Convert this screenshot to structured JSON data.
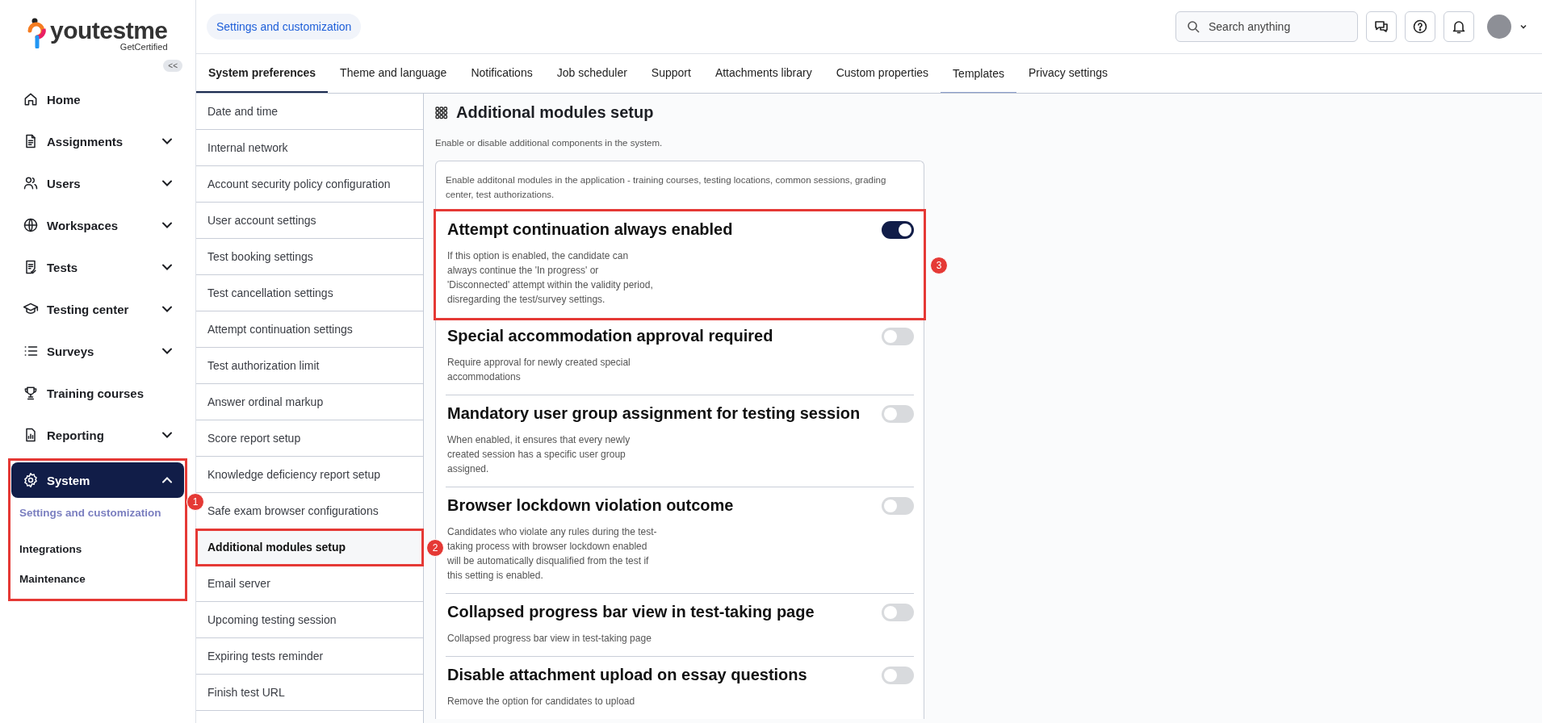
{
  "logo": {
    "name": "youtestme",
    "tagline": "GetCertified"
  },
  "collapse_button": {
    "label": "<<"
  },
  "sidebar": {
    "items": [
      {
        "label": "Home",
        "expandable": false,
        "selected": false
      },
      {
        "label": "Assignments",
        "expandable": true,
        "expanded": false,
        "selected": false
      },
      {
        "label": "Users",
        "expandable": true,
        "expanded": false,
        "selected": false
      },
      {
        "label": "Workspaces",
        "expandable": true,
        "expanded": false,
        "selected": false
      },
      {
        "label": "Tests",
        "expandable": true,
        "expanded": false,
        "selected": false
      },
      {
        "label": "Testing center",
        "expandable": true,
        "expanded": false,
        "selected": false
      },
      {
        "label": "Surveys",
        "expandable": true,
        "expanded": false,
        "selected": false
      },
      {
        "label": "Training courses",
        "expandable": false,
        "selected": false
      },
      {
        "label": "Reporting",
        "expandable": true,
        "expanded": false,
        "selected": false
      },
      {
        "label": "System",
        "expandable": true,
        "expanded": true,
        "selected": true,
        "callout": "1",
        "children": [
          {
            "label": "Settings and customization",
            "selected": true
          },
          {
            "label": "Integrations",
            "selected": false
          },
          {
            "label": "Maintenance",
            "selected": false
          }
        ]
      }
    ]
  },
  "breadcrumb": "Settings and customization",
  "search": {
    "placeholder": "Search anything"
  },
  "tabs": [
    {
      "label": "System preferences",
      "selected": true,
      "hovered": false
    },
    {
      "label": "Theme and language",
      "selected": false,
      "hovered": false
    },
    {
      "label": "Notifications",
      "selected": false,
      "hovered": false
    },
    {
      "label": "Job scheduler",
      "selected": false,
      "hovered": false
    },
    {
      "label": "Support",
      "selected": false,
      "hovered": false
    },
    {
      "label": "Attachments library",
      "selected": false,
      "hovered": false
    },
    {
      "label": "Custom properties",
      "selected": false,
      "hovered": false
    },
    {
      "label": "Templates",
      "selected": false,
      "hovered": true
    },
    {
      "label": "Privacy settings",
      "selected": false,
      "hovered": false
    }
  ],
  "settings_menu": [
    {
      "label": "Date and time",
      "selected": false
    },
    {
      "label": "Internal network",
      "selected": false
    },
    {
      "label": "Account security policy configuration",
      "selected": false
    },
    {
      "label": "User account settings",
      "selected": false
    },
    {
      "label": "Test booking settings",
      "selected": false
    },
    {
      "label": "Test cancellation settings",
      "selected": false
    },
    {
      "label": "Attempt continuation settings",
      "selected": false
    },
    {
      "label": "Test authorization limit",
      "selected": false
    },
    {
      "label": "Answer ordinal markup",
      "selected": false
    },
    {
      "label": "Score report setup",
      "selected": false
    },
    {
      "label": "Knowledge deficiency report setup",
      "selected": false
    },
    {
      "label": "Safe exam browser configurations",
      "selected": false
    },
    {
      "label": "Additional modules setup",
      "selected": true,
      "callout": "2"
    },
    {
      "label": "Email server",
      "selected": false
    },
    {
      "label": "Upcoming testing session",
      "selected": false
    },
    {
      "label": "Expiring tests reminder",
      "selected": false
    },
    {
      "label": "Finish test URL",
      "selected": false
    }
  ],
  "page": {
    "title": "Additional modules setup",
    "subtitle": "Enable or disable additional components in the system.",
    "intro": "Enable additonal modules in the application - training courses, testing locations, common sessions, grading center, test authorizations.",
    "options": [
      {
        "title": "Attempt continuation always enabled",
        "description": "If this option is enabled, the candidate can always continue the 'In progress' or 'Disconnected' attempt within the validity period, disregarding the test/survey settings.",
        "on": true,
        "callout": "3"
      },
      {
        "title": "Special accommodation approval required",
        "description": "Require approval for newly created special accommodations",
        "on": false
      },
      {
        "title": "Mandatory user group assignment for testing session",
        "description": "When enabled, it ensures that every newly created session has a specific user group assigned.",
        "on": false
      },
      {
        "title": "Browser lockdown violation outcome",
        "description": "Candidates who violate any rules during the test-taking process with browser lockdown enabled will be automatically disqualified from the test if this setting is enabled.",
        "on": false
      },
      {
        "title": "Collapsed progress bar view in test-taking page",
        "description": "Collapsed progress bar view in test-taking page",
        "on": false
      },
      {
        "title": "Disable attachment upload on essay questions",
        "description": "Remove the option for candidates to upload",
        "on": false
      }
    ]
  }
}
